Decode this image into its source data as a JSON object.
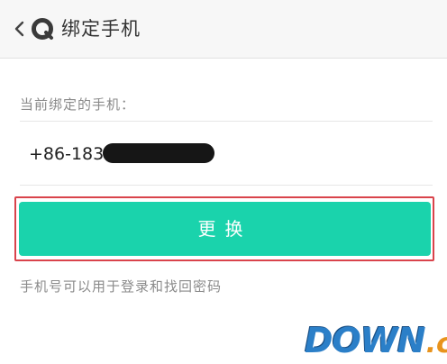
{
  "header": {
    "title": "绑定手机",
    "back_icon": "chevron-left-icon",
    "logo_icon": "app-logo-icon"
  },
  "phone_section": {
    "label": "当前绑定的手机：",
    "number_visible": "+86-183",
    "redacted": true
  },
  "actions": {
    "change_label": "更换"
  },
  "hint": "手机号可以用于登录和找回密码",
  "watermark": {
    "main": "DOWN",
    "tld": ".cc"
  },
  "colors": {
    "accent": "#1ad3ac",
    "highlight_border": "#d9434b",
    "header_bg": "#f7f7f7",
    "watermark_blue": "#2b7fc8",
    "watermark_orange": "#e8931c"
  }
}
